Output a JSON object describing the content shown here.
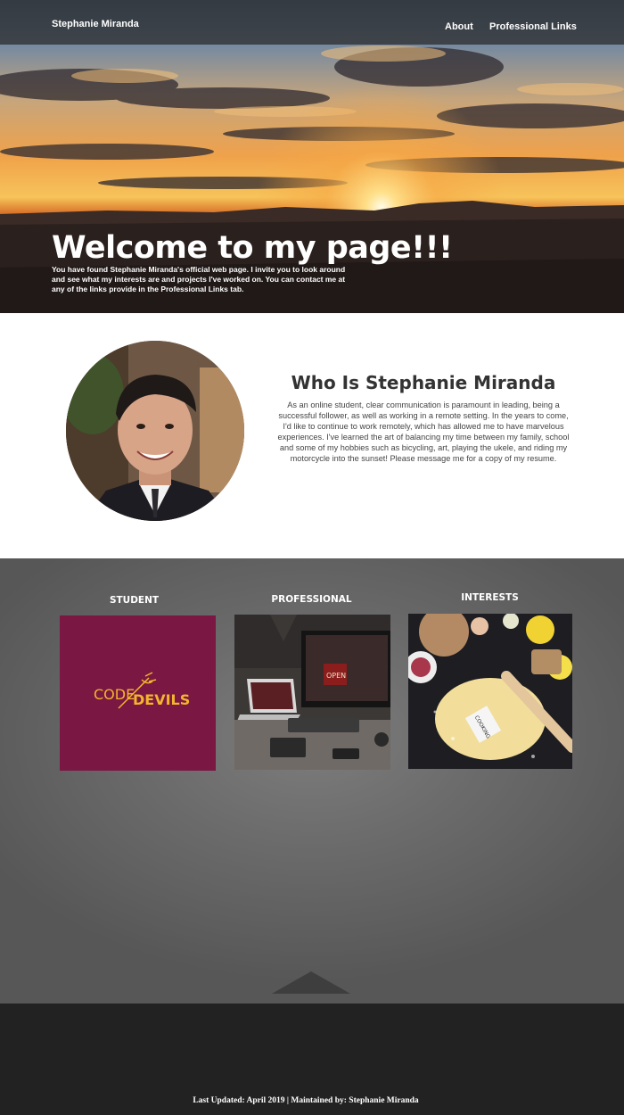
{
  "nav": {
    "brand": "Stephanie Miranda",
    "links": [
      "About",
      "Professional Links"
    ]
  },
  "hero": {
    "title": "Welcome to my page!!!",
    "subtitle": "You have found Stephanie Miranda's official web page. I invite you to look around and see what my interests are and projects I've worked on. You can contact me at any of the links provide in the Professional Links tab."
  },
  "about": {
    "title": "Who Is Stephanie Miranda",
    "body": "As an online student, clear communication is paramount in leading, being a successful follower, as well as working in a remote setting. In the years to come, I'd like to continue to work remotely, which has allowed me to have marvelous experiences. I've learned the art of balancing my time between my family, school and some of my hobbies such as bicycling, art, playing the ukele, and riding my motorcycle into the sunset! Please message me for a copy of my resume."
  },
  "portfolio": {
    "columns": [
      {
        "label": "STUDENT",
        "image": "code-devils-logo",
        "logo_word1": "CODE",
        "logo_word2": "DEVILS"
      },
      {
        "label": "PROFESSIONAL",
        "image": "laptop-desk-photo",
        "sign": "OPEN"
      },
      {
        "label": "INTERESTS",
        "image": "cooking-dough-photo",
        "note": "COOKING"
      }
    ]
  },
  "footer": {
    "text": "Last Updated: April 2019 | Maintained by: Stephanie Miranda"
  },
  "colors": {
    "navbar": "#333333",
    "card_maroon": "#7a1742",
    "logo_gold": "#f2b52e",
    "portfolio_bg": "#6b6b6b",
    "footer_bg": "#222222"
  }
}
